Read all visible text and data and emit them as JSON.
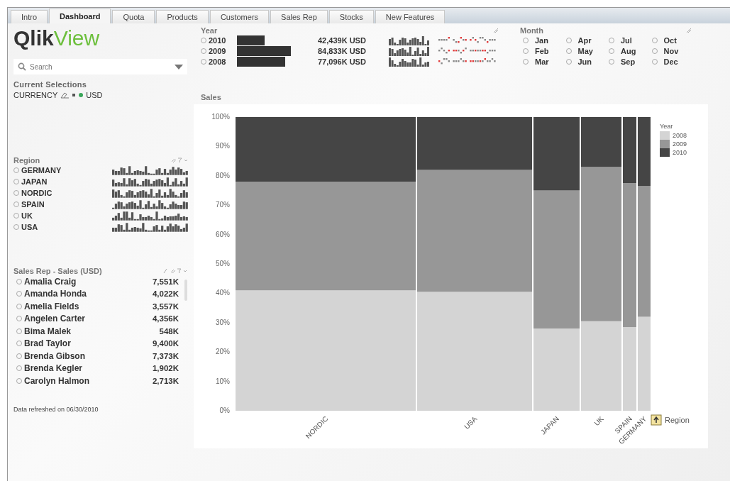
{
  "tabs": [
    {
      "label": "Intro",
      "selected": false
    },
    {
      "label": "Dashboard",
      "selected": true
    },
    {
      "label": "Quota",
      "selected": false
    },
    {
      "label": "Products",
      "selected": false
    },
    {
      "label": "Customers",
      "selected": false
    },
    {
      "label": "Sales Rep",
      "selected": false
    },
    {
      "label": "Stocks",
      "selected": false
    },
    {
      "label": "New Features",
      "selected": false
    }
  ],
  "logo": {
    "part_1": "Qlik",
    "part_2": "View"
  },
  "search": {
    "placeholder": "Search"
  },
  "current_selections": {
    "title": "Current Selections",
    "field": "CURRENCY",
    "value": "USD",
    "color": "#3aa65a"
  },
  "region": {
    "title": "Region",
    "items": [
      {
        "label": "GERMANY",
        "selected": false
      },
      {
        "label": "JAPAN",
        "selected": false
      },
      {
        "label": "NORDIC",
        "selected": false
      },
      {
        "label": "SPAIN",
        "selected": false
      },
      {
        "label": "UK",
        "selected": false
      },
      {
        "label": "USA",
        "selected": false
      }
    ]
  },
  "sales_rep": {
    "title": "Sales Rep - Sales (USD)",
    "rows": [
      {
        "name": "Amalia Craig",
        "value": "7,551K",
        "selected": false
      },
      {
        "name": "Amanda Honda",
        "value": "4,022K",
        "selected": false
      },
      {
        "name": "Amelia Fields",
        "value": "3,557K",
        "selected": false
      },
      {
        "name": "Angelen Carter",
        "value": "4,356K",
        "selected": false
      },
      {
        "name": "Bima Malek",
        "value": "548K",
        "selected": false
      },
      {
        "name": "Brad Taylor",
        "value": "9,400K",
        "selected": false
      },
      {
        "name": "Brenda Gibson",
        "value": "7,373K",
        "selected": false
      },
      {
        "name": "Brenda Kegler",
        "value": "1,902K",
        "selected": false
      },
      {
        "name": "Carolyn Halmon",
        "value": "2,713K",
        "selected": false
      }
    ]
  },
  "footer": "Data refreshed on 06/30/2010",
  "year": {
    "title": "Year",
    "rows": [
      {
        "year": "2010",
        "value": "42,439K USD",
        "selected": false
      },
      {
        "year": "2009",
        "value": "84,833K USD",
        "selected": false
      },
      {
        "year": "2008",
        "value": "77,096K USD",
        "selected": false
      }
    ]
  },
  "month": {
    "title": "Month",
    "items": [
      {
        "label": "Jan",
        "selected": false
      },
      {
        "label": "Apr",
        "selected": false
      },
      {
        "label": "Jul",
        "selected": false
      },
      {
        "label": "Oct",
        "selected": false
      },
      {
        "label": "Feb",
        "selected": false
      },
      {
        "label": "May",
        "selected": false
      },
      {
        "label": "Aug",
        "selected": false
      },
      {
        "label": "Nov",
        "selected": false
      },
      {
        "label": "Mar",
        "selected": false
      },
      {
        "label": "Jun",
        "selected": false
      },
      {
        "label": "Sep",
        "selected": false
      },
      {
        "label": "Dec",
        "selected": false
      }
    ]
  },
  "sales": {
    "title": "Sales",
    "chart_data": {
      "type": "bar",
      "stacked": true,
      "xlabel": "Region",
      "legend": {
        "title": "Year"
      },
      "categories": [
        "NORDIC",
        "USA",
        "JAPAN",
        "UK",
        "SPAIN",
        "GERMANY"
      ],
      "series": [
        {
          "name": "2008",
          "color": "#d4d4d4",
          "values": [
            41,
            40.5,
            28,
            30.5,
            28.5,
            32
          ]
        },
        {
          "name": "2009",
          "color": "#979797",
          "values": [
            37,
            41.5,
            47,
            52.5,
            49,
            44.5
          ]
        },
        {
          "name": "2010",
          "color": "#454545",
          "values": [
            22,
            18,
            25,
            17,
            22.5,
            23.5
          ]
        }
      ],
      "ylim": [
        0,
        100
      ],
      "yticks": [
        {
          "value": 0,
          "label": "0%"
        },
        {
          "value": 10,
          "label": "10%"
        },
        {
          "value": 20,
          "label": "20%"
        },
        {
          "value": 30,
          "label": "30%"
        },
        {
          "value": 40,
          "label": "40%"
        },
        {
          "value": 50,
          "label": "50%"
        },
        {
          "value": 60,
          "label": "60%"
        },
        {
          "value": 70,
          "label": "70%"
        },
        {
          "value": 80,
          "label": "80%"
        },
        {
          "value": 90,
          "label": "90%"
        },
        {
          "value": 100,
          "label": "100%"
        }
      ]
    }
  }
}
